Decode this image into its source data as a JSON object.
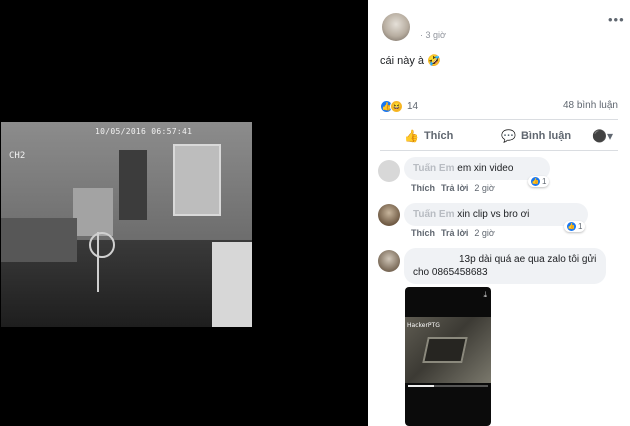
{
  "viewer": {
    "osd_timestamp": "10/05/2016  06:57:41",
    "osd_channel": "CH2"
  },
  "post": {
    "author": "",
    "time": "· 3 giờ",
    "text": "cái này à 🤣",
    "reaction_count": "14",
    "comment_count": "48 bình luận",
    "like_label": "Thích",
    "comment_label": "Bình luận"
  },
  "comments": [
    {
      "author": "Tuấn Em",
      "text": "em xin video",
      "like": "Thích",
      "reply": "Trả lời",
      "time": "2 giờ",
      "reactions": "1"
    },
    {
      "author": "Tuấn Em",
      "text": "xin clip vs bro ơi",
      "like": "Thích",
      "reply": "Trả lời",
      "time": "2 giờ",
      "reactions": "1"
    },
    {
      "author": "",
      "text_line1": "13p dài quá ae qua zalo tôi gửi",
      "text_line2": "cho 0865458683",
      "video_tag": "HackerPTG",
      "video_progress": 0.32
    }
  ],
  "colors": {
    "link": "#385898",
    "like_blue": "#1877f2",
    "meta_gray": "#606770",
    "bubble_bg": "#f0f2f5"
  },
  "icons": {
    "more": "more-horizontal-icon",
    "like": "thumbs-up-icon",
    "comment": "comment-bubble-icon",
    "share": "share-icon",
    "reaction_like": "like-reaction-icon",
    "reaction_haha": "haha-reaction-icon"
  }
}
